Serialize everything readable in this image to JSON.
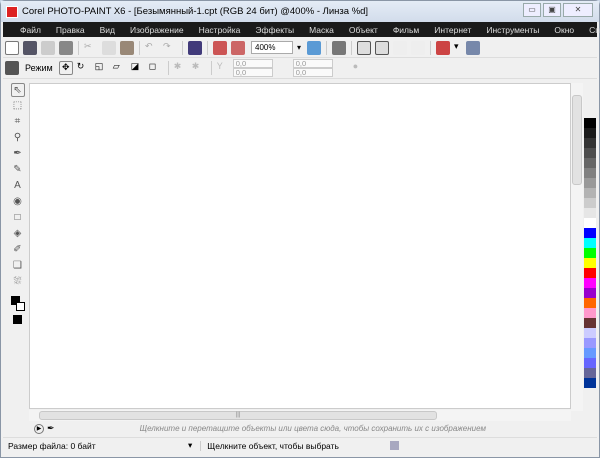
{
  "title": "Corel PHOTO-PAINT X6 - [Безымянный-1.cpt (RGB 24 бит) @400% - Линза %d]",
  "menu": [
    "Файл",
    "Правка",
    "Вид",
    "Изображение",
    "Настройка",
    "Эффекты",
    "Маска",
    "Объект",
    "Фильм",
    "Интернет",
    "Инструменты",
    "Окно",
    "Справка"
  ],
  "toolbar": {
    "zoom": "400%"
  },
  "property_bar": {
    "mode_label": "Режим",
    "x": "0,0",
    "y": "0,0",
    "w": "0,0",
    "h": "0,0"
  },
  "tray": {
    "hint": "Щелкните и перетащите объекты или цвета сюда, чтобы сохранить их с изображением"
  },
  "status": {
    "file_size": "Размер файла: 0 байт",
    "message": "Щелкните объект, чтобы выбрать"
  },
  "palette": [
    "#000000",
    "#1a1a1a",
    "#333333",
    "#4d4d4d",
    "#666666",
    "#808080",
    "#999999",
    "#b3b3b3",
    "#cccccc",
    "#e6e6e6",
    "#ffffff",
    "#0000ff",
    "#00ffff",
    "#00ff00",
    "#ffff00",
    "#ff0000",
    "#ff00ff",
    "#9900cc",
    "#ff6600",
    "#ff99cc",
    "#663333",
    "#ccccff",
    "#9999ff",
    "#6699ff",
    "#6666ff",
    "#666699",
    "#003399"
  ],
  "tools": [
    "pick-tool",
    "mask-tool",
    "crop-tool",
    "zoom-tool",
    "eyedropper-tool",
    "eraser-tool",
    "text-tool",
    "red-eye-tool",
    "shape-tool",
    "fill-tool",
    "brush-tool",
    "effect-tool",
    "object-tool"
  ]
}
